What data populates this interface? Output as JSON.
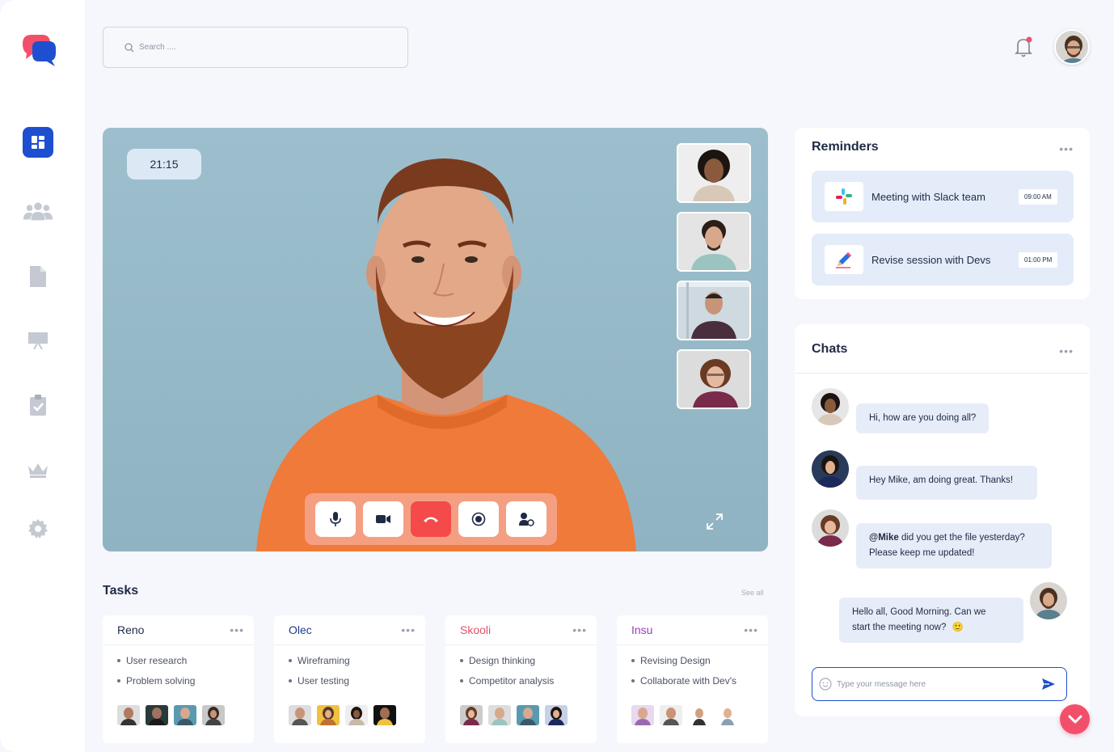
{
  "search": {
    "placeholder": "Search ...."
  },
  "sidebar": {
    "items": [
      {
        "name": "dashboard",
        "icon": "grid-icon",
        "active": true
      },
      {
        "name": "teams",
        "icon": "users-icon"
      },
      {
        "name": "documents",
        "icon": "file-icon"
      },
      {
        "name": "presentation",
        "icon": "presentation-icon"
      },
      {
        "name": "tasks",
        "icon": "clipboard-check-icon"
      },
      {
        "name": "premium",
        "icon": "crown-icon"
      },
      {
        "name": "settings",
        "icon": "gear-icon"
      }
    ]
  },
  "call": {
    "timer": "21:15",
    "controls": [
      "microphone-icon",
      "video-camera-icon",
      "end-call-icon",
      "record-icon",
      "add-participant-icon"
    ]
  },
  "tasks": {
    "title": "Tasks",
    "see_all": "See all",
    "cards": [
      {
        "name": "Reno",
        "color": "#1f2a44",
        "items": [
          "User research",
          "Problem solving"
        ]
      },
      {
        "name": "Olec",
        "color": "#1e3a8a",
        "items": [
          "Wireframing",
          "User testing"
        ]
      },
      {
        "name": "Skooli",
        "color": "#e0506b",
        "items": [
          "Design thinking",
          "Competitor analysis"
        ]
      },
      {
        "name": "Insu",
        "color": "#9b3db8",
        "items": [
          "Revising Design",
          "Collaborate with Dev's"
        ]
      }
    ]
  },
  "reminders": {
    "title": "Reminders",
    "items": [
      {
        "text": "Meeting with Slack team",
        "time": "09:00 AM",
        "icon": "slack-icon"
      },
      {
        "text": "Revise session with Devs",
        "time": "01:00 PM",
        "icon": "pencil-icon"
      }
    ]
  },
  "chats": {
    "title": "Chats",
    "messages": [
      {
        "text": "Hi, how are you doing all?"
      },
      {
        "text": "Hey Mike, am doing great. Thanks!"
      },
      {
        "mention": "@Mike",
        "text": " did you get the file yesterday?",
        "text2": "Please keep me updated!"
      },
      {
        "text": "Hello all, Good Morning. Can we",
        "text2": "start the meeting now?",
        "emoji": "🙂"
      }
    ],
    "input_placeholder": "Type your message here"
  },
  "colors": {
    "accent": "#1e4fd0",
    "end_call": "#f44a4a",
    "control_bar": "#f59f82",
    "fab": "#f2506a"
  }
}
